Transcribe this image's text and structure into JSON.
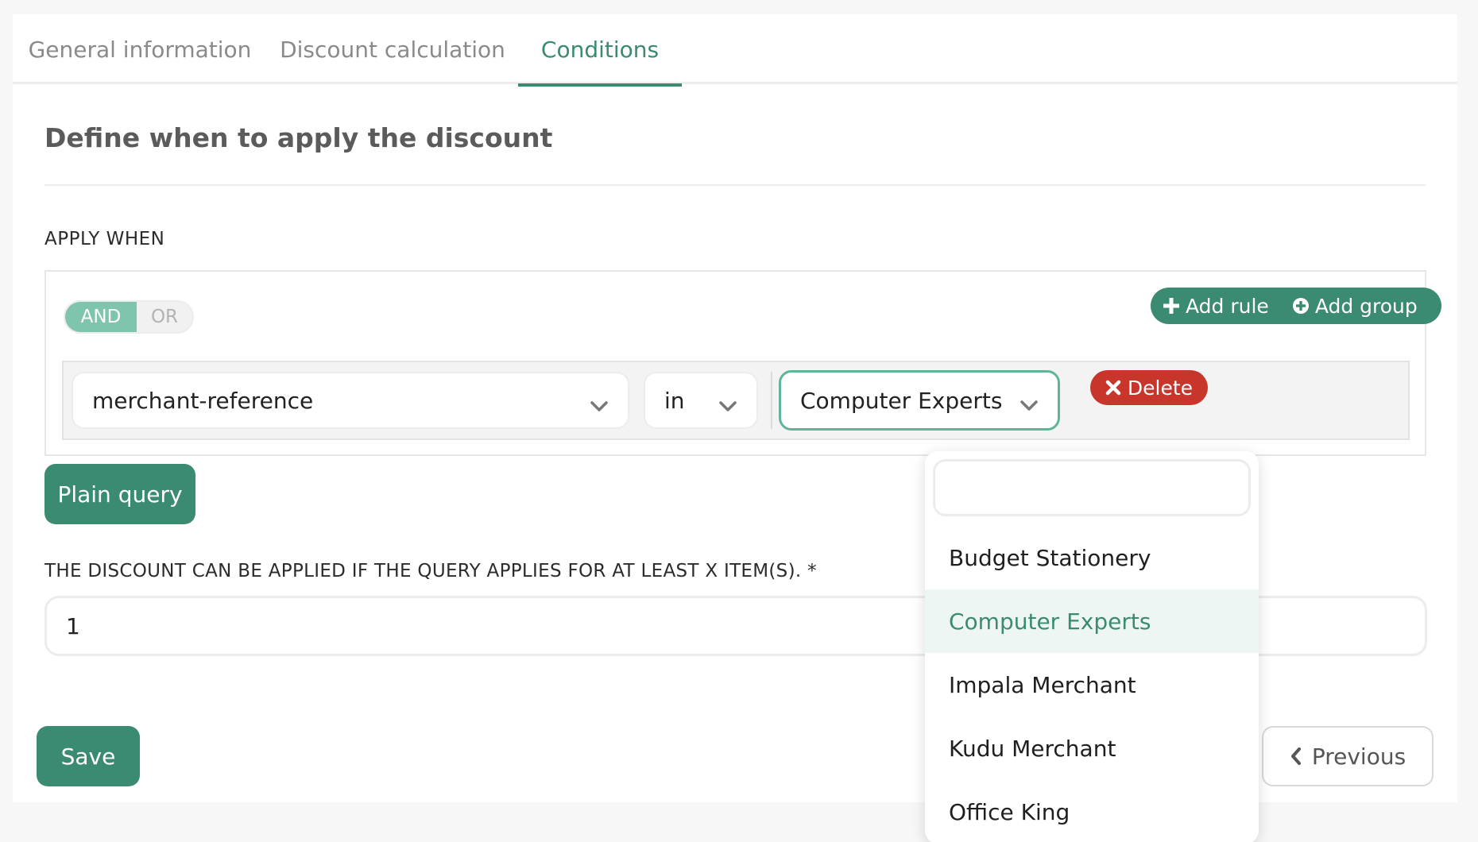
{
  "tabs": [
    {
      "label": "General information"
    },
    {
      "label": "Discount calculation"
    },
    {
      "label": "Conditions"
    }
  ],
  "section_title": "Define when to apply the discount",
  "apply_when_label": "APPLY WHEN",
  "toggle": {
    "and": "AND",
    "or": "OR",
    "selected": "AND"
  },
  "actions": {
    "add_rule": "Add rule",
    "add_group": "Add group"
  },
  "rule": {
    "field": "merchant-reference",
    "operator": "in",
    "value": "Computer Experts",
    "delete_label": "Delete"
  },
  "plain_query_label": "Plain query",
  "min_items_label": "THE DISCOUNT CAN BE APPLIED IF THE QUERY APPLIES FOR AT LEAST X ITEM(S). *",
  "min_items_value": "1",
  "save_label": "Save",
  "previous_label": "Previous",
  "dropdown": {
    "search_value": "",
    "options": [
      "Budget Stationery",
      "Computer Experts",
      "Impala Merchant",
      "Kudu Merchant",
      "Office King"
    ],
    "selected": "Computer Experts"
  },
  "colors": {
    "accent": "#3b8a72",
    "accent_light": "#7fc4ad",
    "danger": "#c8352a"
  }
}
